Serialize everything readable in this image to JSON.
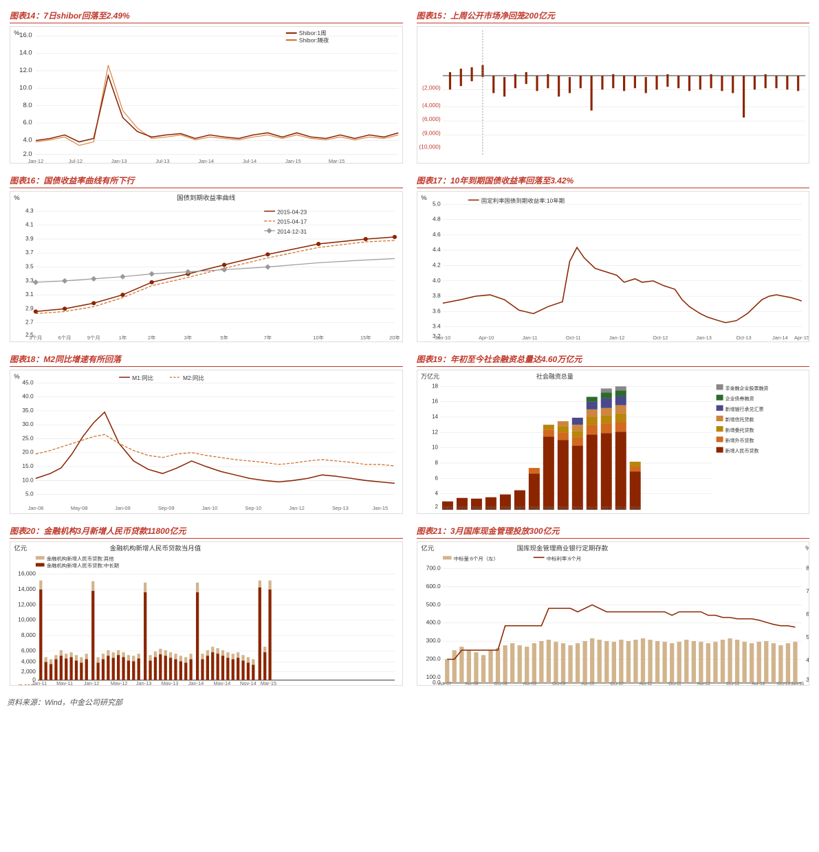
{
  "charts": {
    "chart14": {
      "title": "图表14：7日shibor回落至2.49%",
      "legend": [
        "Shibor:1周",
        "Shibor:隔夜"
      ],
      "yAxisMax": 16.0,
      "yAxisMin": 0.0,
      "colors": [
        "#8B2500",
        "#D2691E"
      ]
    },
    "chart15": {
      "title": "图表15：上周公开市场净回笼200亿元",
      "yLabels": [
        "(2,000)",
        "(4,000)",
        "(6,000)",
        "(9,000)",
        "(10,000)"
      ]
    },
    "chart16": {
      "title": "图表16：国债收益率曲线有所下行",
      "legend": [
        "2015-04-23",
        "2015-04-17",
        "2014-12-31"
      ],
      "yLabel": "%",
      "chartTitle": "国债到期收益率曲线"
    },
    "chart17": {
      "title": "图表17：10年到期国债收益率回落至3.42%",
      "legend": [
        "固定利率国债到期收益率:10年期"
      ],
      "yLabel": "%"
    },
    "chart18": {
      "title": "图表18：M2同比增速有所回落",
      "legend": [
        "M1:同比",
        "M2:同比"
      ],
      "yLabel": "%"
    },
    "chart19": {
      "title": "图表19：年初至今社会融资总量达4.60万亿元",
      "legend": [
        "非金融企业股票融资",
        "企业债券融资",
        "新增银行承兑汇票",
        "新增信托贷款",
        "新增委托贷款",
        "新增外币贷款",
        "新增人民币贷款"
      ],
      "yLabel": "万亿元",
      "chartTitle": "社会融资总量"
    },
    "chart20": {
      "title": "图表20：金融机构3月新增人民币贷款11800亿元",
      "legend": [
        "金融机构新增人民币贷款:其他",
        "金融机构新增人民币贷款:中长期"
      ],
      "yLabel": "亿元",
      "chartTitle": "金融机构新增人民币贷款当月值"
    },
    "chart21": {
      "title": "图表21：3月国库现金管理投放300亿元",
      "legend": [
        "中标量:6个月（左）",
        "中标利率:6个月"
      ],
      "yLabel": "亿元",
      "chartTitle": "国库现金管理商业银行定期存款"
    }
  },
  "footer": "资料来源：Wind，中金公司研究部"
}
